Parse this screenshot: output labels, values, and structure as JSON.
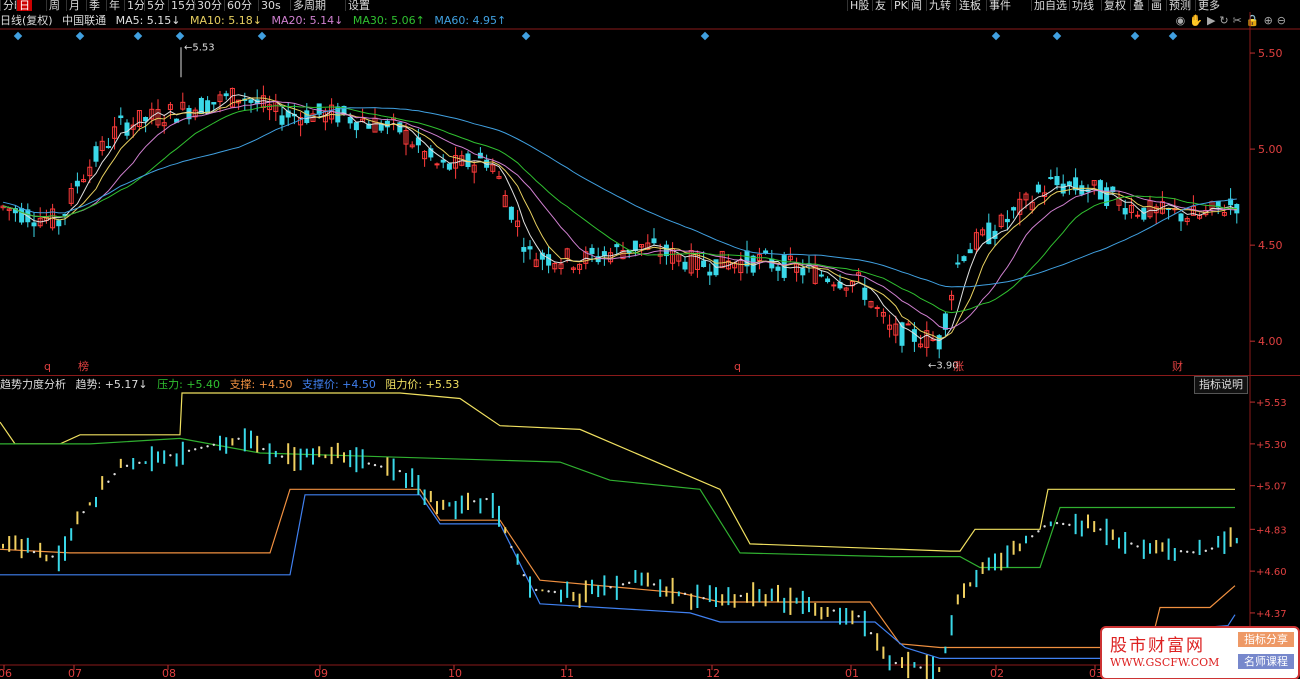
{
  "toolbar": {
    "left": [
      {
        "label": "分时",
        "active": false
      },
      {
        "label": "日",
        "active": true
      },
      {
        "label": "周",
        "active": false
      },
      {
        "label": "月",
        "active": false
      },
      {
        "label": "季",
        "active": false
      },
      {
        "label": "年",
        "active": false
      },
      {
        "label": "1分",
        "active": false
      },
      {
        "label": "5分",
        "active": false
      },
      {
        "label": "15分",
        "active": false
      },
      {
        "label": "30分",
        "active": false
      },
      {
        "label": "60分",
        "active": false
      },
      {
        "label": "30s",
        "active": false
      },
      {
        "label": "多周期",
        "active": false
      },
      {
        "label": "设置",
        "active": false
      }
    ],
    "right": [
      "H股",
      "友",
      "PK",
      "闻",
      "九转",
      "连板",
      "事件",
      "加自选",
      "功线",
      "复权",
      "叠",
      "画",
      "预测",
      "更多"
    ]
  },
  "title": {
    "period": "日线(复权)",
    "stock": "中国联通",
    "ma5": "MA5: 5.15↓",
    "ma10": "MA10: 5.18↓",
    "ma20": "MA20: 5.14↓",
    "ma30": "MA30: 5.06↑",
    "ma60": "MA60: 4.95↑"
  },
  "indicator": {
    "name": "趋势力度分析",
    "trend": "趋势: +5.17↓",
    "pressure": "压力: +5.40",
    "support": "支撑: +4.50",
    "support_price": "支撑价: +4.50",
    "resist_price": "阻力价: +5.53",
    "help": "指标说明"
  },
  "colors": {
    "up": "#ff3b3b",
    "down": "#3ad8e8",
    "ma5": "#e0e0e0",
    "ma10": "#e8d060",
    "ma20": "#d080d0",
    "ma30": "#30c030",
    "ma60": "#40a0e0",
    "resist": "#f0e060",
    "pressure": "#30b030",
    "support": "#f09040",
    "support_price": "#4080f0"
  },
  "price_axis": [
    "5.50",
    "5.00",
    "4.50",
    "4.00"
  ],
  "ind_axis": [
    "+5.53",
    "+5.30",
    "+5.07",
    "+4.83",
    "+4.60",
    "+4.37"
  ],
  "x_axis": [
    "06",
    "07",
    "08",
    "09",
    "10",
    "11",
    "12",
    "01",
    "02",
    "03"
  ],
  "annotations": {
    "high": "5.53",
    "low": "3.90",
    "markers": [
      "q",
      "榜",
      "q",
      "涨",
      "财"
    ]
  },
  "watermark": {
    "title": "股市财富网",
    "url": "WWW.GSCFW.COM",
    "tag1": "指标分享",
    "tag2": "名师课程"
  }
}
